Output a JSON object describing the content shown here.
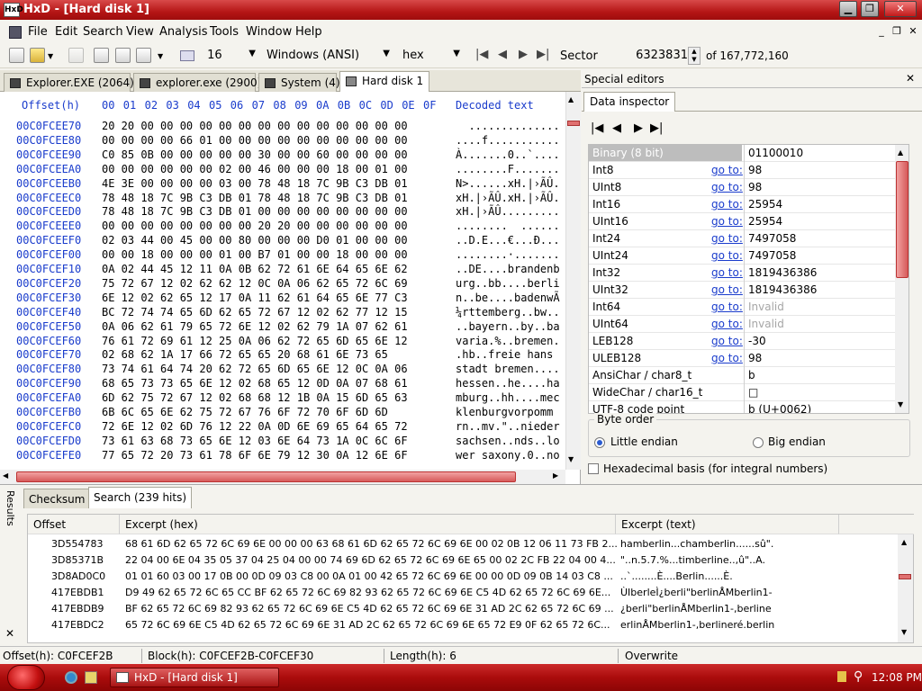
{
  "window": {
    "title": "HxD - [Hard disk 1]",
    "app_icon": "HxD"
  },
  "menu": [
    "File",
    "Edit",
    "Search",
    "View",
    "Analysis",
    "Tools",
    "Window",
    "Help"
  ],
  "toolbar": {
    "bytes_per_row": "16",
    "charset": "Windows (ANSI)",
    "offset_base": "hex",
    "sector_label": "Sector",
    "sector_value": "6323831",
    "sector_total": "of 167,772,160"
  },
  "tabs": [
    {
      "label": "Explorer.EXE (2064)"
    },
    {
      "label": "explorer.exe (2900)"
    },
    {
      "label": "System (4)"
    },
    {
      "label": "Hard disk 1"
    }
  ],
  "hex": {
    "offset_header": "Offset(h)",
    "columns": [
      "00",
      "01",
      "02",
      "03",
      "04",
      "05",
      "06",
      "07",
      "08",
      "09",
      "0A",
      "0B",
      "0C",
      "0D",
      "0E",
      "0F"
    ],
    "decoded_header": "Decoded text",
    "rows": [
      {
        "off": "00C0FCEE70",
        "hex": "20 20 00 00 00 00 00 00 00 00 00 00 00 00 00 00",
        "dec": "  .............."
      },
      {
        "off": "00C0FCEE80",
        "hex": "00 00 00 00 66 01 00 00 00 00 00 00 00 00 00 00",
        "dec": "....f..........."
      },
      {
        "off": "00C0FCEE90",
        "hex": "C0 85 0B 00 00 00 00 00 30 00 00 60 00 00 00 00",
        "dec": "À.......0..`...."
      },
      {
        "off": "00C0FCEEA0",
        "hex": "00 00 00 00 00 00 02 00 46 00 00 00 18 00 01 00",
        "dec": "........F......."
      },
      {
        "off": "00C0FCEEB0",
        "hex": "4E 3E 00 00 00 00 03 00 78 48 18 7C 9B C3 DB 01",
        "dec": "N>......xH.|›ÃÛ."
      },
      {
        "off": "00C0FCEEC0",
        "hex": "78 48 18 7C 9B C3 DB 01 78 48 18 7C 9B C3 DB 01",
        "dec": "xH.|›ÃÛ.xH.|›ÃÛ."
      },
      {
        "off": "00C0FCEED0",
        "hex": "78 48 18 7C 9B C3 DB 01 00 00 00 00 00 00 00 00",
        "dec": "xH.|›ÃÛ........."
      },
      {
        "off": "00C0FCEEE0",
        "hex": "00 00 00 00 00 00 00 00 20 20 00 00 00 00 00 00",
        "dec": "........  ......"
      },
      {
        "off": "00C0FCEEF0",
        "hex": "02 03 44 00 45 00 00 80 00 00 00 D0 01 00 00 00",
        "dec": "..D.E...€...Ð..."
      },
      {
        "off": "00C0FCEF00",
        "hex": "00 00 18 00 00 00 01 00 B7 01 00 00 18 00 00 00",
        "dec": "........·......."
      },
      {
        "off": "00C0FCEF10",
        "hex": "0A 02 44 45 12 11 0A 0B 62 72 61 6E 64 65 6E 62",
        "dec": "..DE....brandenb"
      },
      {
        "off": "00C0FCEF20",
        "hex": "75 72 67 12 02 62 62 12 0C 0A 06 62 65 72 6C 69",
        "dec": "urg..bb....berli"
      },
      {
        "off": "00C0FCEF30",
        "hex": "6E 12 02 62 65 12 17 0A 11 62 61 64 65 6E 77 C3",
        "dec": "n..be....badenwÃ"
      },
      {
        "off": "00C0FCEF40",
        "hex": "BC 72 74 74 65 6D 62 65 72 67 12 02 62 77 12 15",
        "dec": "¼rttemberg..bw.."
      },
      {
        "off": "00C0FCEF50",
        "hex": "0A 06 62 61 79 65 72 6E 12 02 62 79 1A 07 62 61",
        "dec": "..bayern..by..ba"
      },
      {
        "off": "00C0FCEF60",
        "hex": "76 61 72 69 61 12 25 0A 06 62 72 65 6D 65 6E 12",
        "dec": "varia.%..bremen."
      },
      {
        "off": "00C0FCEF70",
        "hex": "02 68 62 1A 17 66 72 65 65 20 68 61 6E 73 65",
        "dec": ".hb..freie hans"
      },
      {
        "off": "00C0FCEF80",
        "hex": "73 74 61 64 74 20 62 72 65 6D 65 6E 12 0C 0A 06",
        "dec": "stadt bremen...."
      },
      {
        "off": "00C0FCEF90",
        "hex": "68 65 73 73 65 6E 12 02 68 65 12 0D 0A 07 68 61",
        "dec": "hessen..he....ha"
      },
      {
        "off": "00C0FCEFA0",
        "hex": "6D 62 75 72 67 12 02 68 68 12 1B 0A 15 6D 65 63",
        "dec": "mburg..hh....mec"
      },
      {
        "off": "00C0FCEFB0",
        "hex": "6B 6C 65 6E 62 75 72 67 76 6F 72 70 6F 6D 6D",
        "dec": "klenburgvorpomm"
      },
      {
        "off": "00C0FCEFC0",
        "hex": "72 6E 12 02 6D 76 12 22 0A 0D 6E 69 65 64 65 72",
        "dec": "rn..mv.\"..nieder"
      },
      {
        "off": "00C0FCEFD0",
        "hex": "73 61 63 68 73 65 6E 12 03 6E 64 73 1A 0C 6C 6F",
        "dec": "sachsen..nds..lo"
      },
      {
        "off": "00C0FCEFE0",
        "hex": "77 65 72 20 73 61 78 6F 6E 79 12 30 0A 12 6E 6F",
        "dec": "wer saxony.0..no"
      }
    ]
  },
  "special_editors": {
    "title": "Special editors",
    "tab": "Data inspector",
    "goto_label": "go to:",
    "rows": [
      {
        "name": "Binary (8 bit)",
        "goto": false,
        "value": "01100010"
      },
      {
        "name": "Int8",
        "goto": true,
        "value": "98"
      },
      {
        "name": "UInt8",
        "goto": true,
        "value": "98"
      },
      {
        "name": "Int16",
        "goto": true,
        "value": "25954"
      },
      {
        "name": "UInt16",
        "goto": true,
        "value": "25954"
      },
      {
        "name": "Int24",
        "goto": true,
        "value": "7497058"
      },
      {
        "name": "UInt24",
        "goto": true,
        "value": "7497058"
      },
      {
        "name": "Int32",
        "goto": true,
        "value": "1819436386"
      },
      {
        "name": "UInt32",
        "goto": true,
        "value": "1819436386"
      },
      {
        "name": "Int64",
        "goto": true,
        "value": "Invalid",
        "invalid": true
      },
      {
        "name": "UInt64",
        "goto": true,
        "value": "Invalid",
        "invalid": true
      },
      {
        "name": "LEB128",
        "goto": true,
        "value": "-30"
      },
      {
        "name": "ULEB128",
        "goto": true,
        "value": "98"
      },
      {
        "name": "AnsiChar / char8_t",
        "goto": false,
        "value": "b"
      },
      {
        "name": "WideChar / char16_t",
        "goto": false,
        "value": "□"
      },
      {
        "name": "UTF-8 code point",
        "goto": false,
        "value": "b (U+0062)"
      }
    ],
    "byte_order_label": "Byte order",
    "little_endian": "Little endian",
    "big_endian": "Big endian",
    "hex_basis": "Hexadecimal basis (for integral numbers)"
  },
  "results": {
    "side_label": "Results",
    "tabs": [
      "Checksum",
      "Search (239 hits)"
    ],
    "headers": [
      "Offset",
      "Excerpt (hex)",
      "Excerpt (text)"
    ],
    "rows": [
      {
        "off": "3D554783",
        "hex": "68 61 6D 62 65 72 6C 69 6E 00 00 00 63 68 61 6D 62 65 72 6C 69 6E 00 02 0B 12 06 11 73 FB 2...",
        "text": "hamberlin...chamberlin......sû\"."
      },
      {
        "off": "3D85371B",
        "hex": "22 04 00 6E 04 35 05 37 04 25 04 00 00 74 69 6D 62 65 72 6C 69 6E 65 00 02 2C FB 22 04 00 4...",
        "text": "\"..n.5.7.%...timberline..,û\"..A."
      },
      {
        "off": "3D8AD0C0",
        "hex": "01 01 60 03 00 17 0B 00 0D 09 03 C8 00 0A 01 00 42 65 72 6C 69 6E 00 00 0D 09 0B 14 03 C8 ...",
        "text": "..`........È....Berlin......È."
      },
      {
        "off": "417EBDB1",
        "hex": "D9 49 62 65 72 6C 65 CC BF 62 65 72 6C 69 82 93 62 65 72 6C 69 6E C5 4D 62 65 72 6C 69 6E...",
        "text": "ÙIberleÌ¿berli\"berlinÅMberlin1-"
      },
      {
        "off": "417EBDB9",
        "hex": "BF 62 65 72 6C 69 82 93 62 65 72 6C 69 6E C5 4D 62 65 72 6C 69 6E 31 AD 2C 62 65 72 6C 69 ...",
        "text": "¿berli\"berlinÅMberlin1-,berline"
      },
      {
        "off": "417EBDC2",
        "hex": "65 72 6C 69 6E C5 4D 62 65 72 6C 69 6E 31 AD 2C 62 65 72 6C 69 6E 65 72 E9 0F 62 65 72 6C...",
        "text": "erlinÅMberlin1-,berlineré.berlin"
      }
    ]
  },
  "status": {
    "offset": "Offset(h): C0FCEF2B",
    "block": "Block(h): C0FCEF2B-C0FCEF30",
    "length": "Length(h): 6",
    "mode": "Overwrite"
  },
  "taskbar": {
    "item": "HxD - [Hard disk 1]",
    "clock": "12:08 PM"
  }
}
